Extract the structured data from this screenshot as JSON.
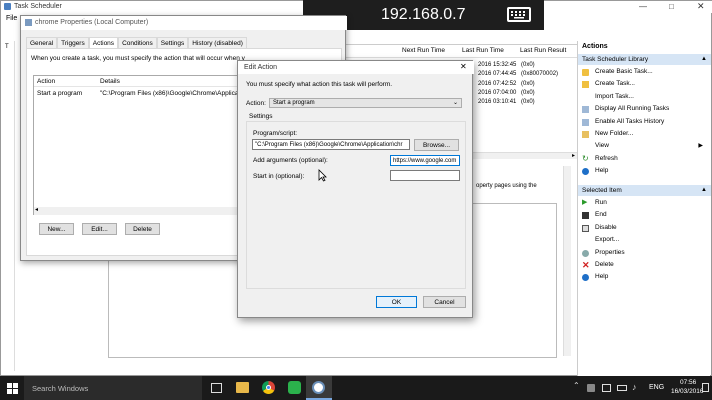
{
  "main_window": {
    "title": "Task Scheduler",
    "menu_file": "File",
    "columns": [
      "Next Run Time",
      "Last Run Time",
      "Last Run Result"
    ],
    "rows": [
      {
        "last_run": "2016 15:32:45",
        "result": "(0x0)"
      },
      {
        "last_run": "2016 07:44:45",
        "result": "(0x80070002)"
      },
      {
        "last_run": "2016 07:42:52",
        "result": "(0x0)"
      },
      {
        "last_run": "2016 07:04:00",
        "result": "(0x0)"
      },
      {
        "last_run": "2016 03:10:41",
        "result": "(0x0)"
      }
    ],
    "partial_text": "operty pages using the"
  },
  "remote_bar": {
    "ip": "192.168.0.7"
  },
  "actions_panel": {
    "header": "Actions",
    "section1": "Task Scheduler Library",
    "items1": [
      "Create Basic Task...",
      "Create Task...",
      "Import Task...",
      "Display All Running Tasks",
      "Enable All Tasks History",
      "New Folder...",
      "View",
      "Refresh",
      "Help"
    ],
    "section2": "Selected Item",
    "items2": [
      "Run",
      "End",
      "Disable",
      "Export...",
      "Properties",
      "Delete",
      "Help"
    ]
  },
  "props_dialog": {
    "title": "chrome Properties (Local Computer)",
    "tabs": [
      "General",
      "Triggers",
      "Actions",
      "Conditions",
      "Settings",
      "History (disabled)"
    ],
    "intro": "When you create a task, you must specify the action that will occur when your task starts.",
    "col_action": "Action",
    "col_details": "Details",
    "row_action": "Start a program",
    "row_details": "\"C:\\Program Files (x86)\\Google\\Chrome\\Applicatio",
    "new_label": "New...",
    "edit_label": "Edit...",
    "delete_label": "Delete"
  },
  "edit_dialog": {
    "title": "Edit Action",
    "instruction": "You must specify what action this task will perform.",
    "action_label": "Action:",
    "action_value": "Start a program",
    "settings_label": "Settings",
    "program_label": "Program/script:",
    "program_value": "\"C:\\Program Files (x86)\\Google\\Chrome\\Application\\chr",
    "browse_label": "Browse...",
    "args_label": "Add arguments (optional):",
    "args_value": "https://www.google.com",
    "start_in_label": "Start in (optional):",
    "start_in_value": "",
    "ok_label": "OK",
    "cancel_label": "Cancel"
  },
  "taskbar": {
    "search": "Search Windows",
    "lang": "ENG",
    "time": "07:56",
    "date": "16/03/2016"
  }
}
